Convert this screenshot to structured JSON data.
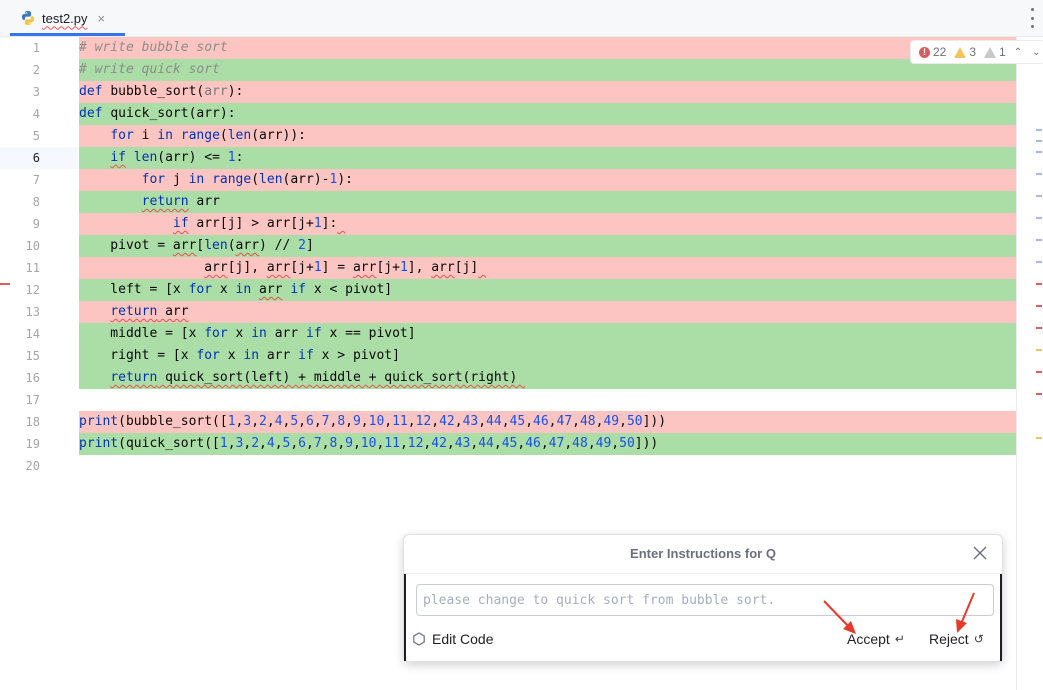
{
  "tab": {
    "filename": "test2.py",
    "close_label": "×"
  },
  "inspection": {
    "errors": "22",
    "warnings": "3",
    "weak_warnings": "1"
  },
  "lines": [
    {
      "n": "1",
      "kind": "del",
      "tokens": [
        [
          "cm",
          "# write bubble sort"
        ]
      ]
    },
    {
      "n": "2",
      "kind": "add",
      "tokens": [
        [
          "cm",
          "# write quick sort"
        ]
      ]
    },
    {
      "n": "3",
      "kind": "del",
      "tokens": [
        [
          "kw",
          "def "
        ],
        [
          "",
          "bubble_sort("
        ],
        [
          "param",
          "arr"
        ],
        [
          "",
          "):"
        ]
      ]
    },
    {
      "n": "4",
      "kind": "add",
      "tokens": [
        [
          "kw",
          "def "
        ],
        [
          "",
          "quick_sort(arr):"
        ]
      ]
    },
    {
      "n": "5",
      "kind": "del",
      "tokens": [
        [
          "",
          "    "
        ],
        [
          "kw",
          "for "
        ],
        [
          "",
          "i "
        ],
        [
          "kw",
          "in "
        ],
        [
          "kw",
          "range"
        ],
        [
          "",
          "("
        ],
        [
          "kw",
          "len"
        ],
        [
          "",
          "(arr)):"
        ]
      ]
    },
    {
      "n": "6",
      "kind": "add",
      "current": true,
      "tokens": [
        [
          "",
          "    "
        ],
        [
          "kw err",
          "if"
        ],
        [
          "",
          " "
        ],
        [
          "kw",
          "len"
        ],
        [
          "",
          "(arr) <= "
        ],
        [
          "num",
          "1"
        ],
        [
          "",
          ":"
        ]
      ]
    },
    {
      "n": "7",
      "kind": "del",
      "tokens": [
        [
          "",
          "        "
        ],
        [
          "kw",
          "for "
        ],
        [
          "",
          "j "
        ],
        [
          "kw",
          "in "
        ],
        [
          "kw",
          "range"
        ],
        [
          "",
          "("
        ],
        [
          "kw",
          "len"
        ],
        [
          "",
          "(arr)-"
        ],
        [
          "num",
          "1"
        ],
        [
          "",
          "):"
        ]
      ]
    },
    {
      "n": "8",
      "kind": "add",
      "tokens": [
        [
          "",
          "        "
        ],
        [
          "kw err",
          "return"
        ],
        [
          "",
          " arr"
        ]
      ]
    },
    {
      "n": "9",
      "kind": "del",
      "tokens": [
        [
          "",
          "            "
        ],
        [
          "kw err",
          "if"
        ],
        [
          "",
          " arr[j] > arr[j+"
        ],
        [
          "num",
          "1"
        ],
        [
          "",
          "]:"
        ],
        [
          "err",
          " "
        ]
      ]
    },
    {
      "n": "10",
      "kind": "add",
      "tokens": [
        [
          "",
          "    pivot = "
        ],
        [
          "err",
          "arr"
        ],
        [
          "",
          "["
        ],
        [
          "kw",
          "len"
        ],
        [
          "",
          "("
        ],
        [
          "err",
          "arr"
        ],
        [
          "",
          ") // "
        ],
        [
          "num",
          "2"
        ],
        [
          "",
          "]"
        ]
      ]
    },
    {
      "n": "11",
      "kind": "del",
      "tokens": [
        [
          "",
          "                "
        ],
        [
          "err",
          "arr"
        ],
        [
          "",
          "[j], "
        ],
        [
          "err",
          "arr"
        ],
        [
          "",
          "[j+"
        ],
        [
          "num",
          "1"
        ],
        [
          "",
          "] = "
        ],
        [
          "err",
          "arr"
        ],
        [
          "",
          "[j+"
        ],
        [
          "num",
          "1"
        ],
        [
          "",
          "], "
        ],
        [
          "err",
          "arr"
        ],
        [
          "",
          "[j]"
        ],
        [
          "err",
          " "
        ]
      ]
    },
    {
      "n": "12",
      "kind": "add",
      "tokens": [
        [
          "",
          "    left = [x "
        ],
        [
          "kw",
          "for "
        ],
        [
          "",
          "x "
        ],
        [
          "kw",
          "in "
        ],
        [
          "err",
          "arr"
        ],
        [
          "",
          " "
        ],
        [
          "kw",
          "if "
        ],
        [
          "",
          "x < pivot]"
        ]
      ]
    },
    {
      "n": "13",
      "kind": "del",
      "tokens": [
        [
          "",
          "    "
        ],
        [
          "kw err",
          "return"
        ],
        [
          "err",
          " arr"
        ]
      ]
    },
    {
      "n": "14",
      "kind": "add",
      "tokens": [
        [
          "",
          "    middle = [x "
        ],
        [
          "kw",
          "for "
        ],
        [
          "",
          "x "
        ],
        [
          "kw",
          "in "
        ],
        [
          "",
          "arr "
        ],
        [
          "kw",
          "if "
        ],
        [
          "",
          "x == pivot]"
        ]
      ]
    },
    {
      "n": "15",
      "kind": "add",
      "tokens": [
        [
          "",
          "    right = [x "
        ],
        [
          "kw",
          "for "
        ],
        [
          "",
          "x "
        ],
        [
          "kw",
          "in "
        ],
        [
          "",
          "arr "
        ],
        [
          "kw",
          "if "
        ],
        [
          "",
          "x > pivot]"
        ]
      ]
    },
    {
      "n": "16",
      "kind": "add",
      "tokens": [
        [
          "",
          "    "
        ],
        [
          "kw err",
          "return"
        ],
        [
          "err",
          " quick_sort(left) + middle + quick_sort(right) "
        ]
      ]
    },
    {
      "n": "17",
      "kind": "none",
      "tokens": []
    },
    {
      "n": "18",
      "kind": "del",
      "tokens": [
        [
          "kw",
          "print"
        ],
        [
          "",
          "(bubble_sort(["
        ],
        [
          "num",
          "1"
        ],
        [
          "",
          ","
        ],
        [
          "num",
          "3"
        ],
        [
          "",
          ","
        ],
        [
          "num",
          "2"
        ],
        [
          "",
          ","
        ],
        [
          "num",
          "4"
        ],
        [
          "",
          ","
        ],
        [
          "num",
          "5"
        ],
        [
          "",
          ","
        ],
        [
          "num",
          "6"
        ],
        [
          "",
          ","
        ],
        [
          "num",
          "7"
        ],
        [
          "",
          ","
        ],
        [
          "num",
          "8"
        ],
        [
          "",
          ","
        ],
        [
          "num",
          "9"
        ],
        [
          "",
          ","
        ],
        [
          "num",
          "10"
        ],
        [
          "",
          ","
        ],
        [
          "num",
          "11"
        ],
        [
          "",
          ","
        ],
        [
          "num",
          "12"
        ],
        [
          "",
          ","
        ],
        [
          "num",
          "42"
        ],
        [
          "",
          ","
        ],
        [
          "num",
          "43"
        ],
        [
          "",
          ","
        ],
        [
          "num",
          "44"
        ],
        [
          "",
          ","
        ],
        [
          "num",
          "45"
        ],
        [
          "",
          ","
        ],
        [
          "num",
          "46"
        ],
        [
          "",
          ","
        ],
        [
          "num",
          "47"
        ],
        [
          "",
          ","
        ],
        [
          "num",
          "48"
        ],
        [
          "",
          ","
        ],
        [
          "num",
          "49"
        ],
        [
          "",
          ","
        ],
        [
          "num",
          "50"
        ],
        [
          "",
          "]))"
        ]
      ]
    },
    {
      "n": "19",
      "kind": "add",
      "tokens": [
        [
          "kw",
          "print"
        ],
        [
          "",
          "(quick_sort(["
        ],
        [
          "num",
          "1"
        ],
        [
          "",
          ","
        ],
        [
          "num",
          "3"
        ],
        [
          "",
          ","
        ],
        [
          "num",
          "2"
        ],
        [
          "",
          ","
        ],
        [
          "num",
          "4"
        ],
        [
          "",
          ","
        ],
        [
          "num",
          "5"
        ],
        [
          "",
          ","
        ],
        [
          "num",
          "6"
        ],
        [
          "",
          ","
        ],
        [
          "num",
          "7"
        ],
        [
          "",
          ","
        ],
        [
          "num",
          "8"
        ],
        [
          "",
          ","
        ],
        [
          "num",
          "9"
        ],
        [
          "",
          ","
        ],
        [
          "num",
          "10"
        ],
        [
          "",
          ","
        ],
        [
          "num",
          "11"
        ],
        [
          "",
          ","
        ],
        [
          "num",
          "12"
        ],
        [
          "",
          ","
        ],
        [
          "num",
          "42"
        ],
        [
          "",
          ","
        ],
        [
          "num",
          "43"
        ],
        [
          "",
          ","
        ],
        [
          "num",
          "44"
        ],
        [
          "",
          ","
        ],
        [
          "num",
          "45"
        ],
        [
          "",
          ","
        ],
        [
          "num",
          "46"
        ],
        [
          "",
          ","
        ],
        [
          "num",
          "47"
        ],
        [
          "",
          ","
        ],
        [
          "num",
          "48"
        ],
        [
          "",
          ","
        ],
        [
          "num",
          "49"
        ],
        [
          "",
          ","
        ],
        [
          "num",
          "50"
        ],
        [
          "",
          "]))"
        ]
      ]
    },
    {
      "n": "20",
      "kind": "none",
      "tokens": []
    }
  ],
  "popup": {
    "title": "Enter Instructions for Q",
    "input_placeholder": "please change to quick sort from bubble sort.",
    "input_value": "",
    "edit_code_label": "Edit Code",
    "accept_label": "Accept",
    "accept_symbol": "↵",
    "reject_label": "Reject",
    "reject_symbol": "↺"
  },
  "colors": {
    "deleted_bg": "#fdc5c1",
    "added_bg": "#abdda6",
    "keyword": "#0033b3",
    "number": "#1750eb",
    "arrow": "#e8392b"
  }
}
